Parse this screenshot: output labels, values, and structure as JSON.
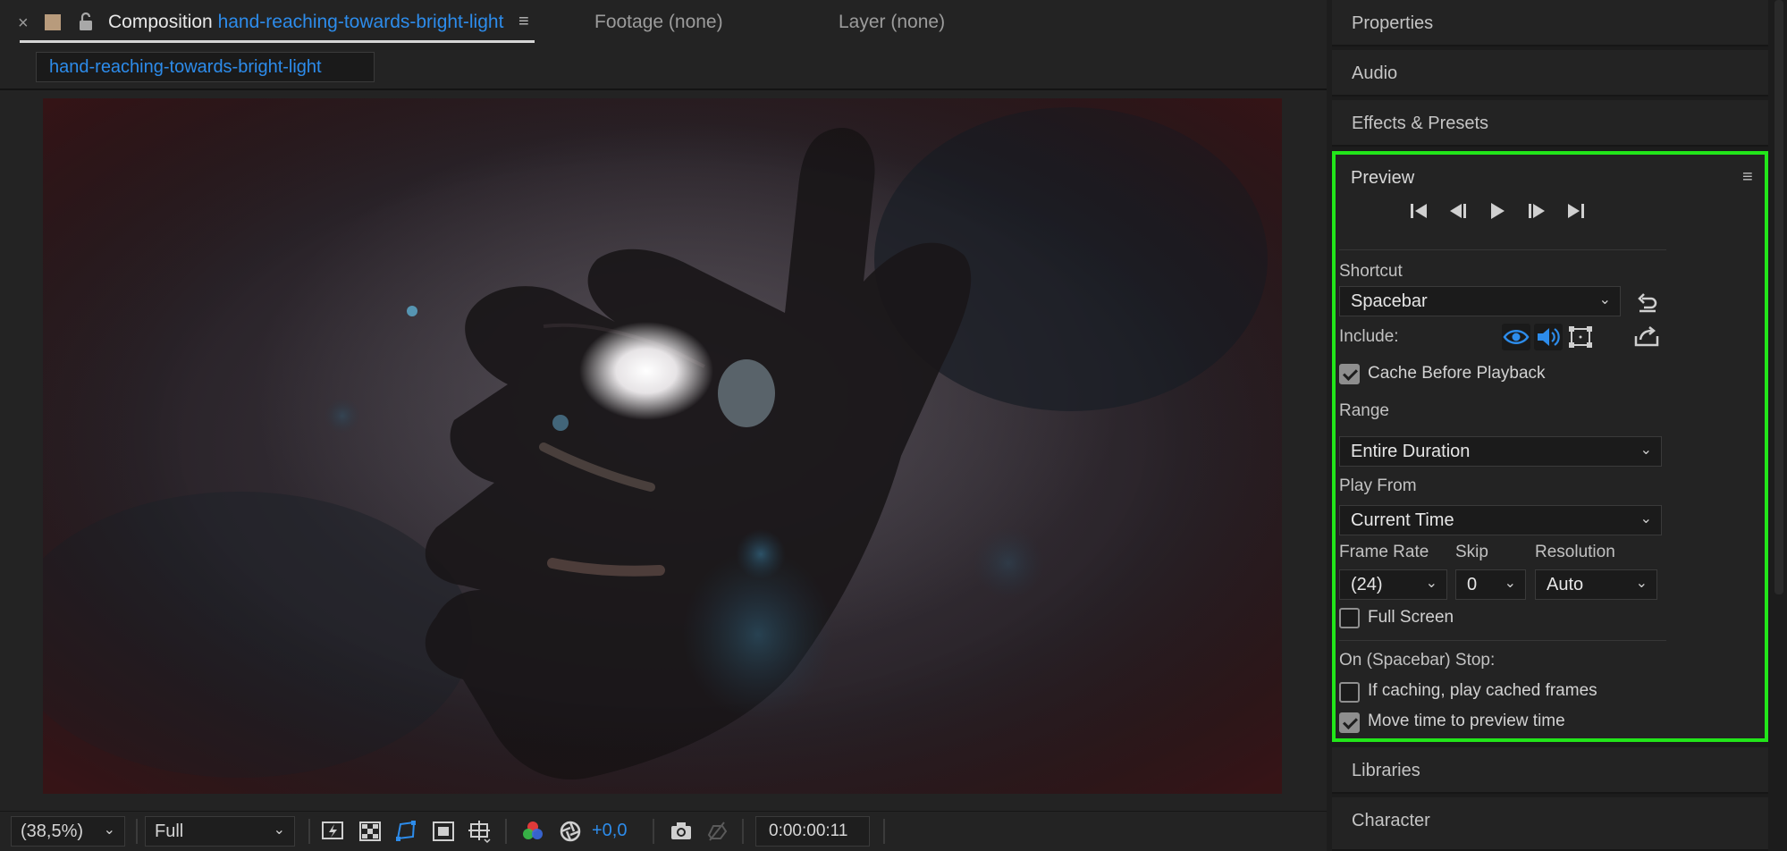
{
  "composition_tab": {
    "close_symbol": "×",
    "prefix": "Composition",
    "name": "hand-reaching-towards-bright-light",
    "menu_symbol": "≡"
  },
  "viewer_tabs": {
    "footage": "Footage (none)",
    "layer": "Layer (none)"
  },
  "comp_chip": "hand-reaching-towards-bright-light",
  "bottom_bar": {
    "magnification": "(38,5%)",
    "resolution": "Full",
    "exposure": "+0,0",
    "timecode": "0:00:00:11"
  },
  "side_panels": {
    "properties": "Properties",
    "audio": "Audio",
    "effects": "Effects & Presets",
    "libraries": "Libraries",
    "character": "Character"
  },
  "preview": {
    "title": "Preview",
    "menu_symbol": "≡",
    "shortcut_label": "Shortcut",
    "shortcut_value": "Spacebar",
    "include_label": "Include:",
    "include_video_on": true,
    "include_audio_on": true,
    "cache_before_playback": {
      "label": "Cache Before Playback",
      "checked": true
    },
    "range_label": "Range",
    "range_value": "Entire Duration",
    "play_from_label": "Play From",
    "play_from_value": "Current Time",
    "frame_rate_label": "Frame Rate",
    "frame_rate_value": "(24)",
    "skip_label": "Skip",
    "skip_value": "0",
    "resolution_label": "Resolution",
    "resolution_value": "Auto",
    "full_screen": {
      "label": "Full Screen",
      "checked": false
    },
    "stop_label": "On (Spacebar) Stop:",
    "if_caching": {
      "label": "If caching, play cached frames",
      "checked": false
    },
    "move_time": {
      "label": "Move time to preview time",
      "checked": true
    }
  },
  "colors": {
    "accent_blue": "#2d8ceb",
    "highlight_green": "#22e61a",
    "panel_bg": "#232323"
  },
  "icons": [
    "close-icon",
    "lock-icon",
    "panel-menu-icon",
    "first-frame-icon",
    "previous-frame-icon",
    "play-icon",
    "next-frame-icon",
    "last-frame-icon",
    "reset-shortcut-icon",
    "video-eye-icon",
    "audio-speaker-icon",
    "overlays-icon",
    "export-icon",
    "fast-preview-icon",
    "transparency-grid-icon",
    "mask-path-icon",
    "region-of-interest-icon",
    "guides-icon",
    "rgb-channels-icon",
    "reset-exposure-icon",
    "snapshot-icon",
    "show-snapshot-icon"
  ]
}
